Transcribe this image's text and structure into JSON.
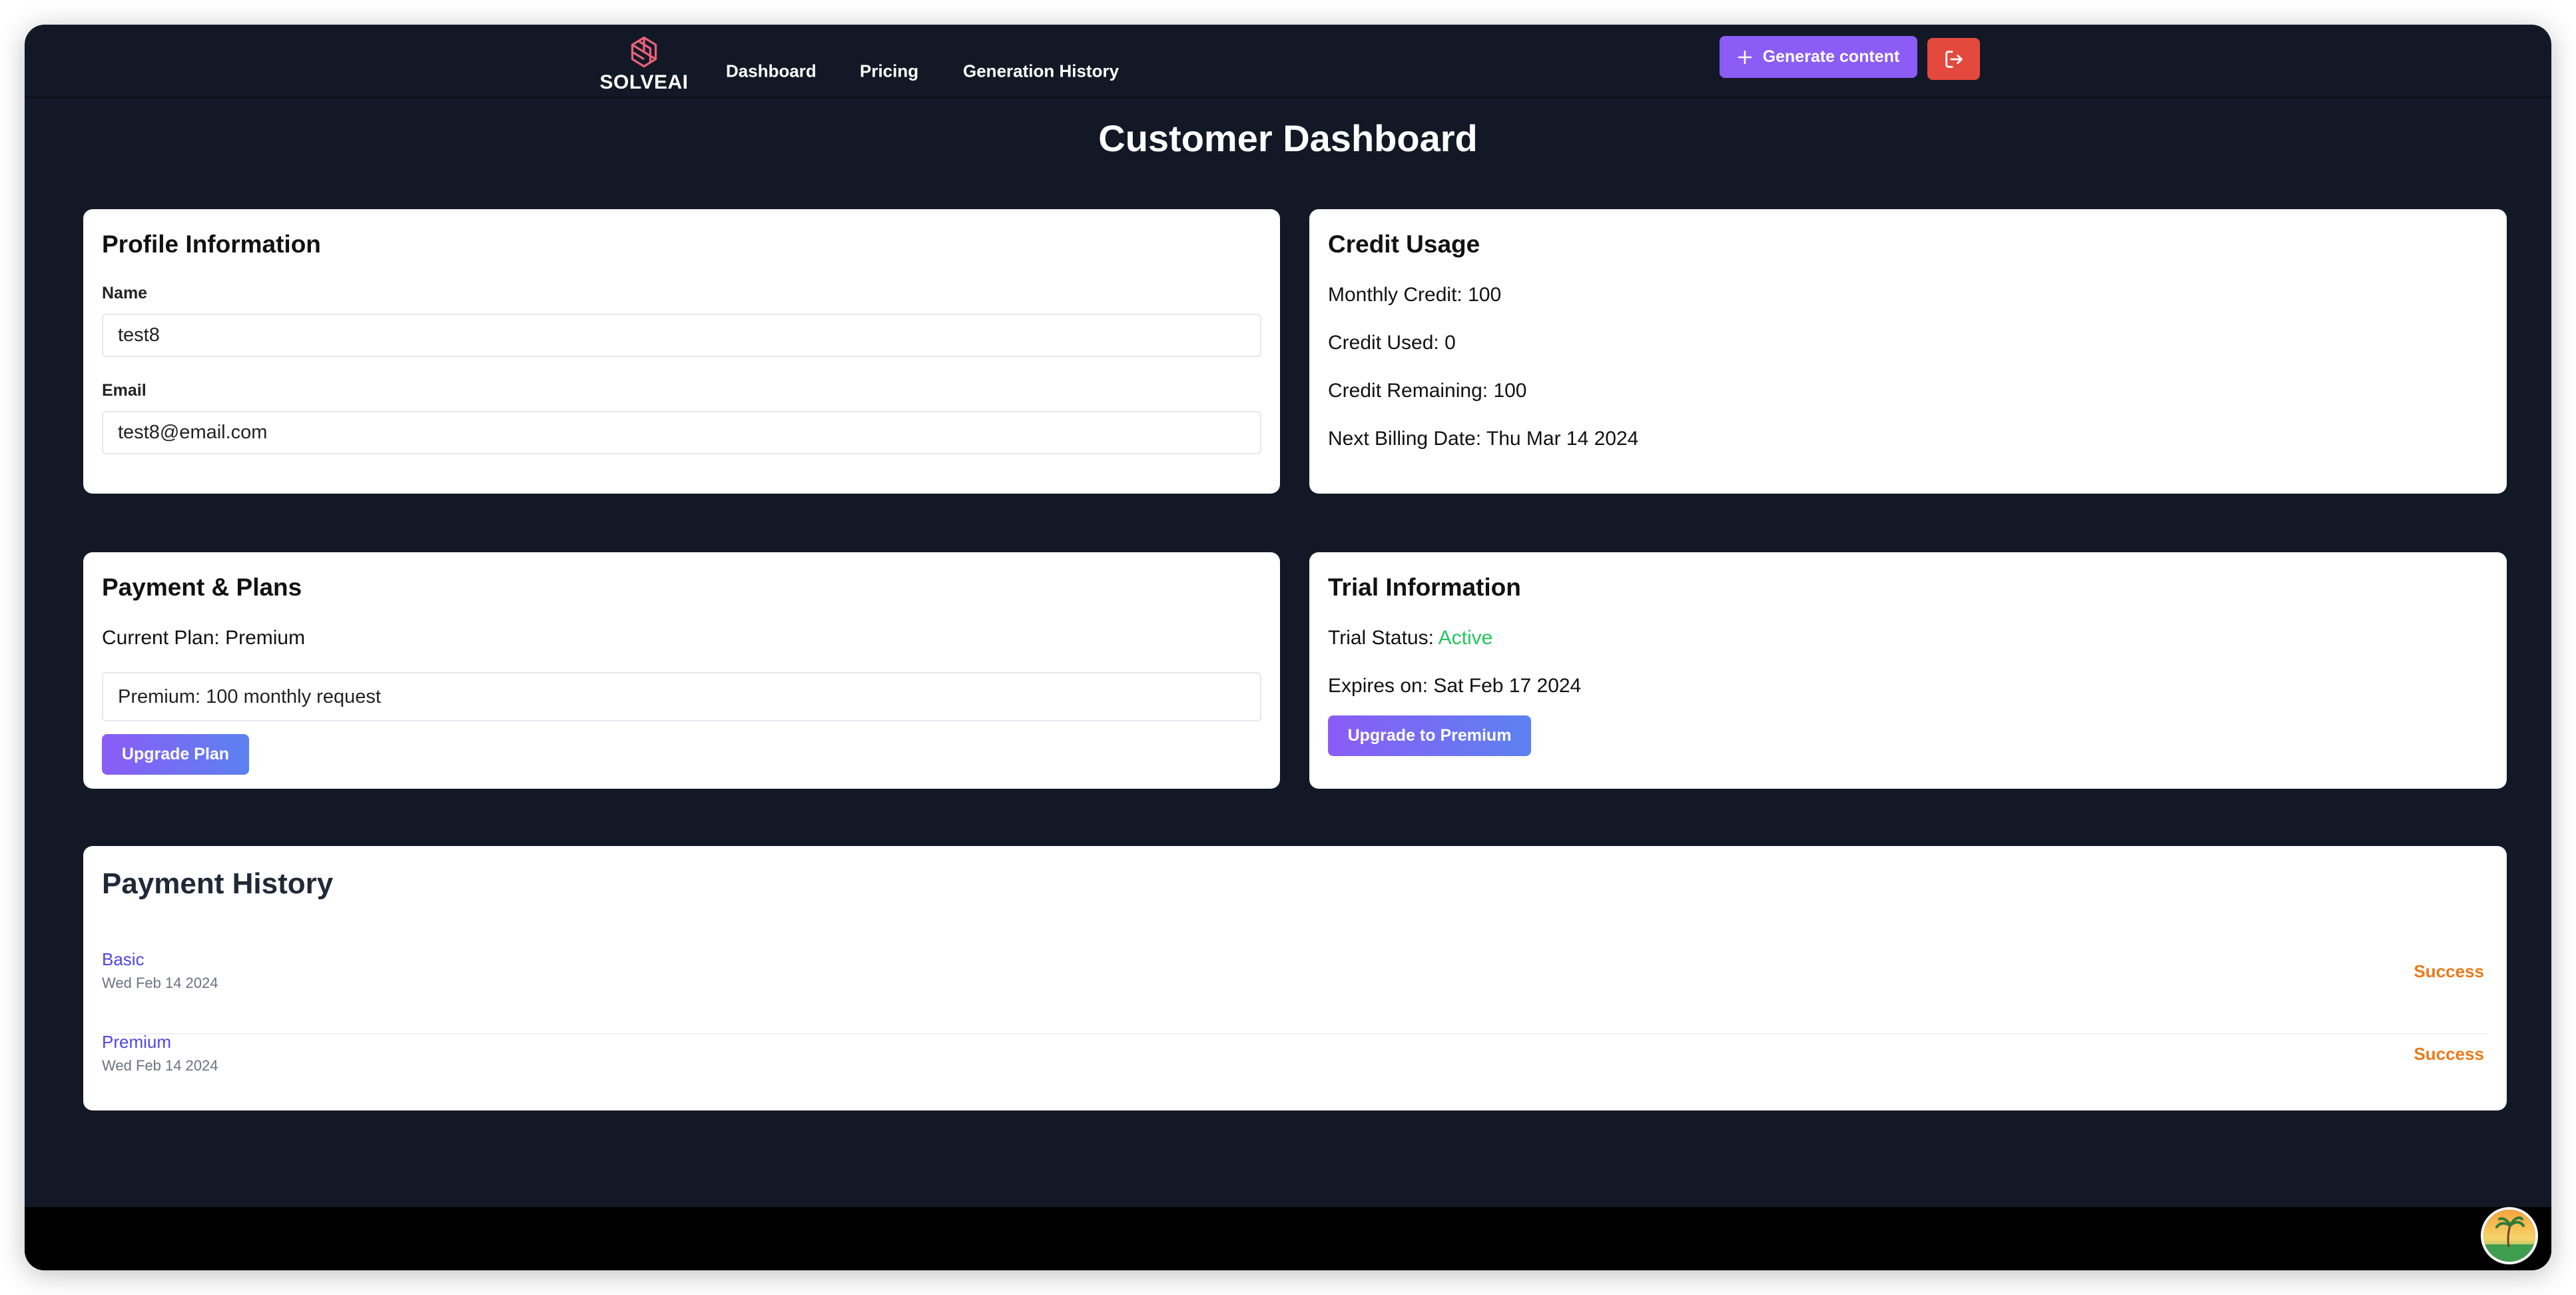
{
  "nav": {
    "logo_text": "SOLVEAI",
    "links": [
      "Dashboard",
      "Pricing",
      "Generation History"
    ],
    "generate_label": "Generate content"
  },
  "page": {
    "title": "Customer Dashboard"
  },
  "profile": {
    "title": "Profile Information",
    "name_label": "Name",
    "name_value": "test8",
    "email_label": "Email",
    "email_value": "test8@email.com"
  },
  "credit": {
    "title": "Credit Usage",
    "monthly": "Monthly Credit: 100",
    "used": "Credit Used: 0",
    "remaining": "Credit Remaining: 100",
    "next_billing": "Next Billing Date: Thu Mar 14 2024"
  },
  "payment": {
    "title": "Payment & Plans",
    "current_plan": "Current Plan: Premium",
    "plan_option": "Premium: 100 monthly request",
    "upgrade_label": "Upgrade Plan"
  },
  "trial": {
    "title": "Trial Information",
    "status_prefix": "Trial Status: ",
    "status_value": "Active",
    "expires": "Expires on: Sat Feb 17 2024",
    "upgrade_label": "Upgrade to Premium"
  },
  "history": {
    "title": "Payment History",
    "rows": [
      {
        "plan": "Basic",
        "date": "Wed Feb 14 2024",
        "status": "Success"
      },
      {
        "plan": "Premium",
        "date": "Wed Feb 14 2024",
        "status": "Success"
      }
    ]
  },
  "colors": {
    "background": "#131826",
    "accent": "#8b5cf6",
    "danger": "#e3493c",
    "active": "#22c55e",
    "success": "#ea7a1a",
    "link": "#4f46e5"
  },
  "icons": [
    "solveai-logo-icon",
    "plus-icon",
    "logout-icon",
    "avatar-icon"
  ]
}
